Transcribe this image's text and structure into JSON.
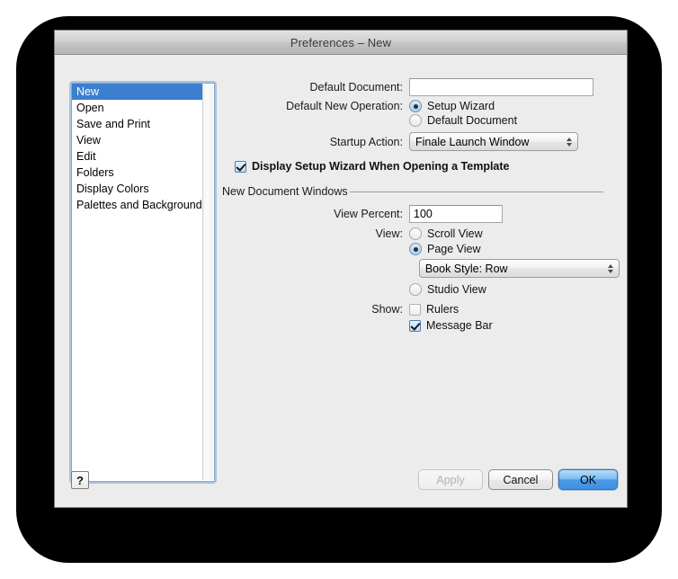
{
  "window": {
    "title": "Preferences – New"
  },
  "sidebar": {
    "items": [
      {
        "label": "New",
        "selected": true
      },
      {
        "label": "Open",
        "selected": false
      },
      {
        "label": "Save and Print",
        "selected": false
      },
      {
        "label": "View",
        "selected": false
      },
      {
        "label": "Edit",
        "selected": false
      },
      {
        "label": "Folders",
        "selected": false
      },
      {
        "label": "Display Colors",
        "selected": false
      },
      {
        "label": "Palettes and Backgrounds",
        "selected": false
      }
    ]
  },
  "form": {
    "default_document_label": "Default Document:",
    "default_document_value": "",
    "default_new_operation_label": "Default New Operation:",
    "setup_wizard_label": "Setup Wizard",
    "default_document_radio_label": "Default Document",
    "startup_action_label": "Startup Action:",
    "startup_action_value": "Finale Launch Window",
    "display_setup_wizard_label": "Display Setup Wizard When Opening a Template"
  },
  "group": {
    "title": "New Document Windows",
    "view_percent_label": "View Percent:",
    "view_percent_value": "100",
    "view_label": "View:",
    "scroll_view_label": "Scroll View",
    "page_view_label": "Page View",
    "book_style_value": "Book Style: Row",
    "studio_view_label": "Studio View",
    "show_label": "Show:",
    "rulers_label": "Rulers",
    "message_bar_label": "Message Bar"
  },
  "footer": {
    "help_label": "?",
    "apply_label": "Apply",
    "cancel_label": "Cancel",
    "ok_label": "OK"
  },
  "colors": {
    "selection_blue": "#3c7fd0",
    "default_button_blue": "#4c9ae8",
    "window_background": "#ececec"
  }
}
